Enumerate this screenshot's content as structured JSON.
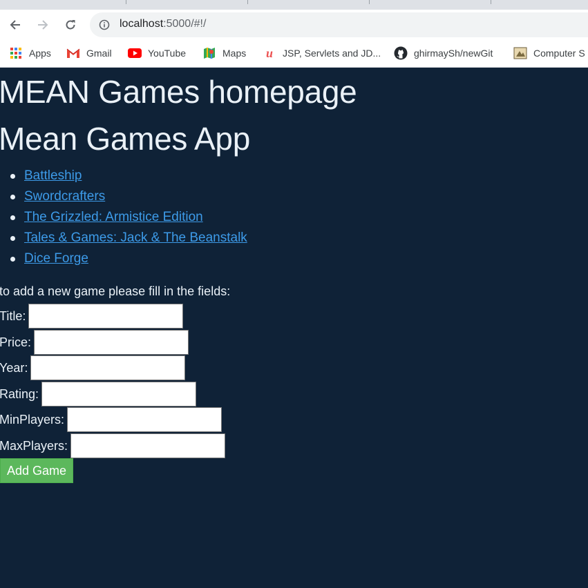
{
  "browser": {
    "url_host": "localhost",
    "url_path": ":5000/#!/",
    "bookmarks": [
      {
        "label": "Apps",
        "icon": "apps-grid-icon"
      },
      {
        "label": "Gmail",
        "icon": "gmail-icon"
      },
      {
        "label": "YouTube",
        "icon": "youtube-icon"
      },
      {
        "label": "Maps",
        "icon": "maps-icon"
      },
      {
        "label": "JSP, Servlets and JD...",
        "icon": "udemy-icon"
      },
      {
        "label": "ghirmaySh/newGit",
        "icon": "github-icon"
      },
      {
        "label": "Computer S",
        "icon": "computer-icon"
      }
    ]
  },
  "page": {
    "title": "MEAN Games homepage",
    "app_title": "Mean Games App",
    "games": [
      "Battleship",
      "Swordcrafters",
      "The Grizzled: Armistice Edition",
      "Tales & Games: Jack & The Beanstalk",
      "Dice Forge"
    ],
    "form": {
      "intro": "to add a new game please fill in the fields:",
      "fields": [
        {
          "label": "Title:",
          "value": ""
        },
        {
          "label": "Price:",
          "value": ""
        },
        {
          "label": "Year:",
          "value": ""
        },
        {
          "label": "Rating:",
          "value": ""
        },
        {
          "label": "MinPlayers:",
          "value": ""
        },
        {
          "label": "MaxPlayers:",
          "value": ""
        }
      ],
      "submit_label": "Add Game"
    }
  },
  "colors": {
    "page_bg": "#0f2237",
    "link": "#3d9be9",
    "button": "#5cb85c"
  }
}
